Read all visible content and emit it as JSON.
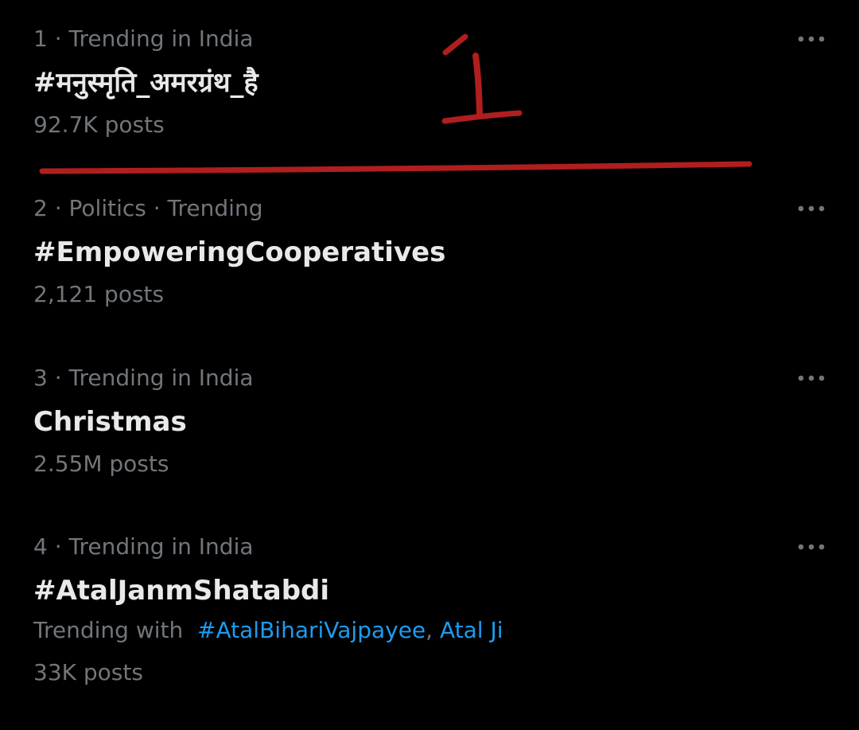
{
  "trends": [
    {
      "rank": "1",
      "context": "Trending in India",
      "name": "#मनुस्मृति_अमरग्रंथ_है",
      "posts": "92.7K posts"
    },
    {
      "rank": "2",
      "context": "Politics · Trending",
      "name": "#EmpoweringCooperatives",
      "posts": "2,121 posts"
    },
    {
      "rank": "3",
      "context": "Trending in India",
      "name": "Christmas",
      "posts": "2.55M posts"
    },
    {
      "rank": "4",
      "context": "Trending in India",
      "name": "#AtalJanmShatabdi",
      "posts": "33K posts",
      "trending_with_label": "Trending with",
      "trending_with": [
        "#AtalBihariVajpayee",
        "Atal Ji"
      ]
    }
  ],
  "separator": " · ",
  "more_icon": "more-horizontal-icon",
  "colors": {
    "background": "#000000",
    "primary_text": "#e7e9ea",
    "secondary_text": "#71767b",
    "link": "#1d9bf0",
    "annotation": "#b01e1e"
  }
}
